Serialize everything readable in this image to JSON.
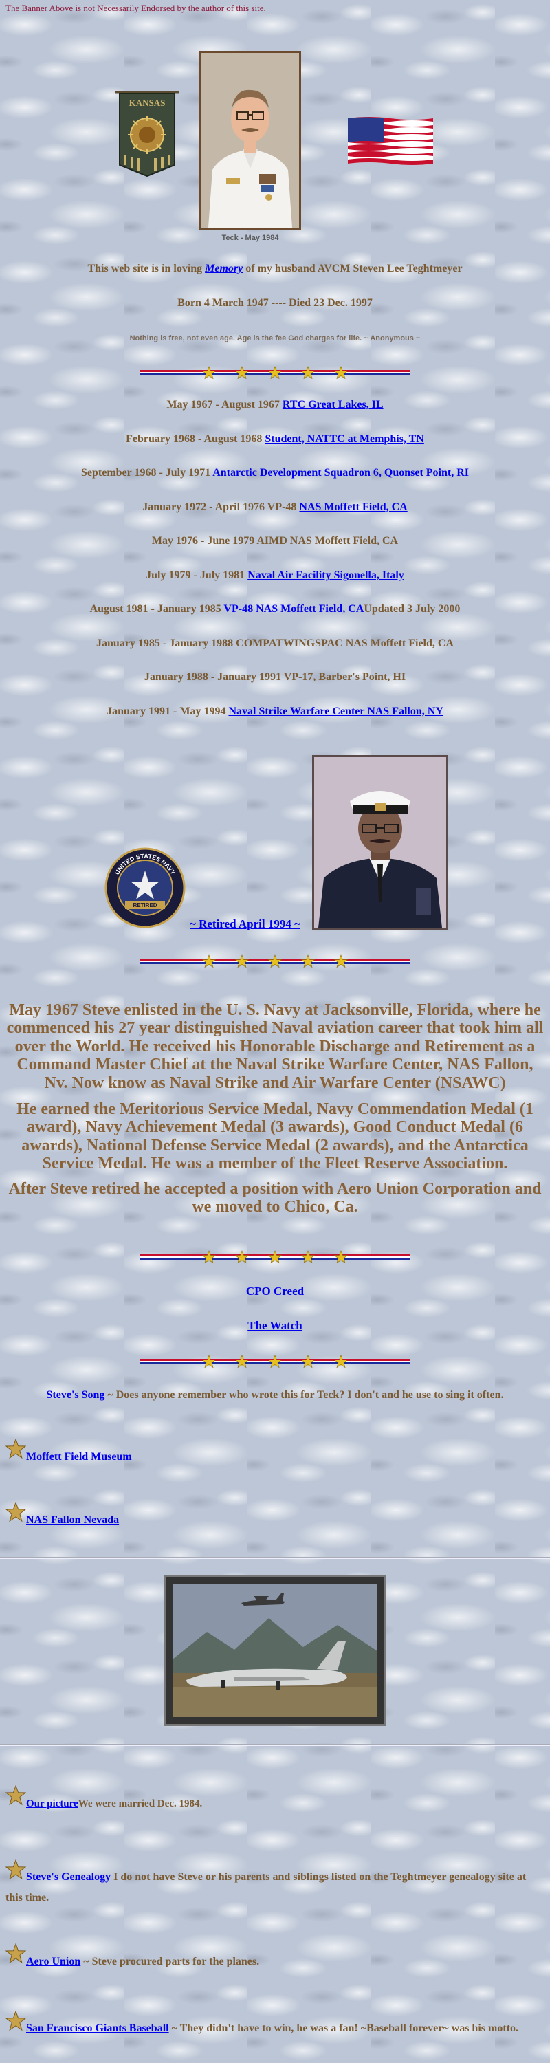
{
  "header": {
    "banner_note": "The Banner Above is not Necessarily Endorsed by the author of this site."
  },
  "images": {
    "kansas_banner_text": "KANSAS",
    "portrait_caption": "Teck - May 1984",
    "retired_seal_text": [
      "UNITED STATES NAVY",
      "RETIRED"
    ]
  },
  "dedication": {
    "prefix": "This web site is in loving ",
    "memory_link": "Memory",
    "suffix": " of my husband AVCM Steven Lee Teghtmeyer",
    "dates": "Born 4 March 1947 ---- Died 23 Dec. 1997",
    "quote": "Nothing is free, not even age. Age is the fee God charges for life. ~ Anonymous ~"
  },
  "service": [
    {
      "text": "May 1967 - August 1967 ",
      "link": "RTC Great Lakes, IL",
      "after": ""
    },
    {
      "text": "February 1968 - August 1968 ",
      "link": "Student, NATTC at Memphis, TN",
      "after": ""
    },
    {
      "text": "September 1968 - July 1971 ",
      "link": "Antarctic Development Squadron 6, Quonset Point, RI",
      "after": ""
    },
    {
      "text": "January 1972 - April 1976 VP-48 ",
      "link": "NAS Moffett Field, CA",
      "after": ""
    },
    {
      "text": "May 1976 - June 1979 AIMD NAS Moffett Field, CA",
      "link": "",
      "after": ""
    },
    {
      "text": "July 1979 - July 1981 ",
      "link": "Naval Air Facility Sigonella, Italy",
      "after": ""
    },
    {
      "text": "August 1981 - January 1985 ",
      "link": "VP-48 NAS Moffett Field, CA",
      "after": "Updated 3 July 2000"
    },
    {
      "text": "January 1985 - January 1988 COMPATWINGSPAC NAS Moffett Field, CA",
      "link": "",
      "after": ""
    },
    {
      "text": "January 1988 - January 1991 VP-17, Barber's Point, HI",
      "link": "",
      "after": ""
    },
    {
      "text": "January 1991 - May 1994 ",
      "link": "Naval Strike Warfare Center NAS Fallon, NY",
      "after": ""
    }
  ],
  "retired": {
    "link": "~ Retired April 1994 ~"
  },
  "biography": [
    "May 1967 Steve enlisted in the U. S. Navy at Jacksonville, Florida, where he commenced his 27 year distinguished Naval aviation career that took him all over the World. He received his Honorable Discharge and Retirement as a Command Master Chief at the Naval Strike Warfare Center, NAS Fallon, Nv. Now know as Naval Strike and Air Warfare Center (NSAWC)",
    "He earned the Meritorious Service Medal, Navy Commendation Medal (1 award), Navy Achievement Medal (3 awards), Good Conduct Medal (6 awards), National Defense Service Medal (2 awards), and the Antarctica Service Medal. He was a member of the Fleet Reserve Association.",
    "After Steve retired he accepted a position with Aero Union Corporation and we moved to Chico, Ca."
  ],
  "links": {
    "cpo_creed": "CPO Creed",
    "the_watch": "The Watch",
    "steves_song": "Steve's Song",
    "steves_song_note": " ~ Does anyone remember who wrote this for Teck? I don't and he use to sing it often.",
    "moffett_museum": "Moffett Field Museum",
    "nas_fallon": "NAS Fallon Nevada",
    "our_picture": "Our picture",
    "our_picture_note": "We were married Dec. 1984.",
    "genealogy": "Steve's Genealogy",
    "genealogy_note": " I do not have Steve or his parents and siblings listed on the Teghtmeyer genealogy site at this time.",
    "aero_union": "Aero Union",
    "aero_union_note": " ~ Steve procured parts for the planes.",
    "giants": "San Francisco Giants Baseball",
    "giants_note": " ~ They didn't have to win, he was a fan! ~Baseball forever~ was his motto."
  },
  "colors": {
    "text_brown": "#7a5a32",
    "link_blue": "#0000ee",
    "banner_note": "#8b1a3a"
  },
  "icons": [
    "gold-star-icon",
    "flag-divider-icon"
  ]
}
